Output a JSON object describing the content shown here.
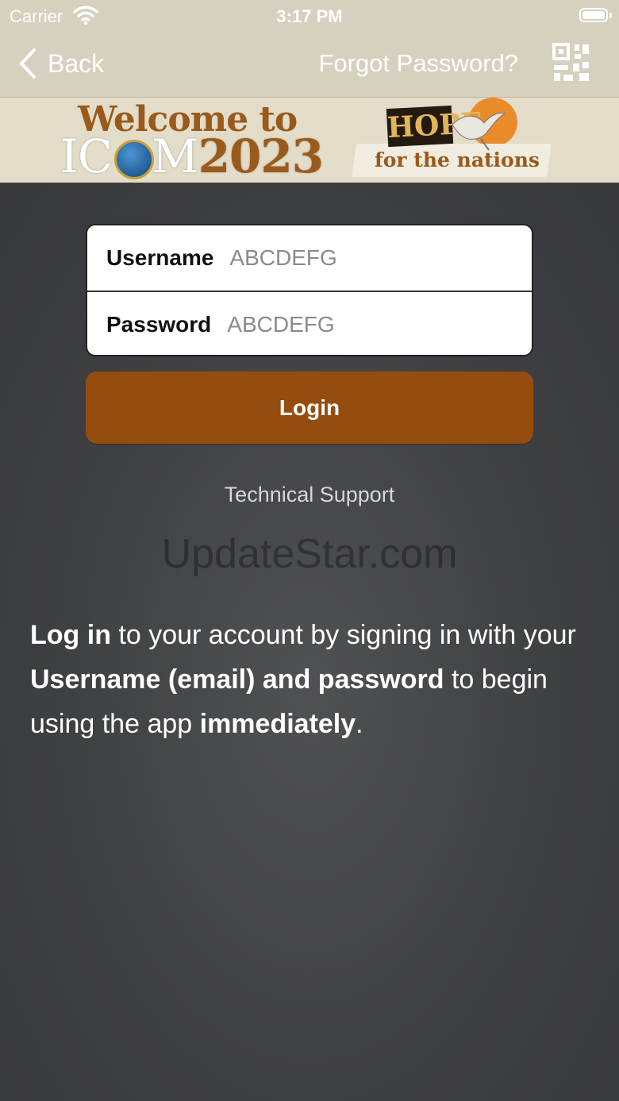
{
  "status_bar": {
    "carrier": "Carrier",
    "time": "3:17 PM"
  },
  "nav": {
    "back_label": "Back",
    "forgot_label": "Forgot Password?",
    "qr_icon": "qr-code-icon"
  },
  "banner": {
    "welcome": "Welcome to",
    "icom_prefix": "IC",
    "icom_suffix": "M",
    "year": "2023",
    "hope": "HOPE",
    "for_nations": "for the nations"
  },
  "form": {
    "username_label": "Username",
    "username_placeholder": "ABCDEFG",
    "password_label": "Password",
    "password_placeholder": "ABCDEFG"
  },
  "login_label": "Login",
  "support_label": "Technical Support",
  "watermark": "UpdateStar.com",
  "info": {
    "p1_bold": "Log in",
    "p2": " to your account by signing in with your ",
    "p3_bold": "Username (email) and password",
    "p4": " to begin using the app ",
    "p5_bold": "immediately",
    "p6": "."
  },
  "colors": {
    "login_button": "#944d0e",
    "header_bg": "#d6d0bf",
    "body_bg": "#3f4043"
  }
}
